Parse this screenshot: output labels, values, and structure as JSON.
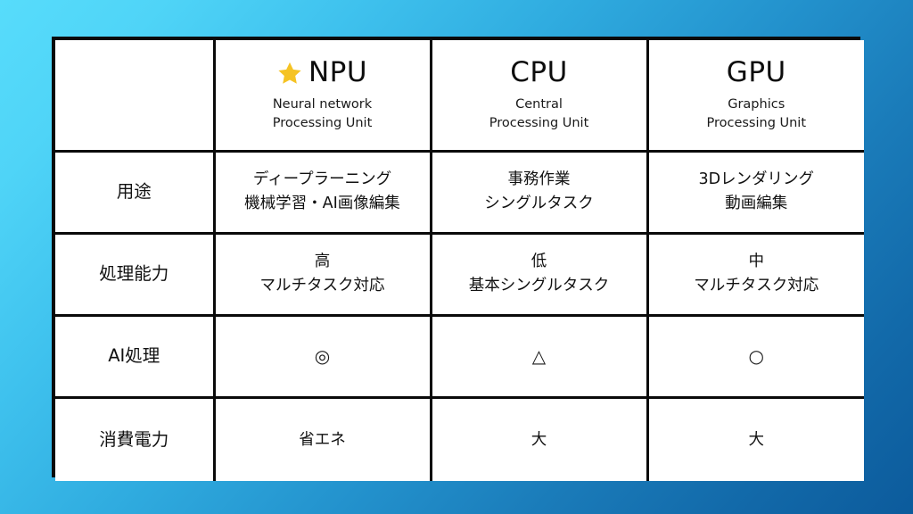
{
  "slide": {
    "background_from": "#57dcfb",
    "background_to": "#0c5b9c",
    "border_color": "#0a0a0a",
    "star_color": "#f5c324"
  },
  "table": {
    "corner_label": "",
    "columns": [
      {
        "key": "npu",
        "abbr": "NPU",
        "expansion_line1": "Neural network",
        "expansion_line2": "Processing Unit",
        "highlighted": true,
        "star_icon": "star-icon"
      },
      {
        "key": "cpu",
        "abbr": "CPU",
        "expansion_line1": "Central",
        "expansion_line2": "Processing Unit",
        "highlighted": false,
        "star_icon": ""
      },
      {
        "key": "gpu",
        "abbr": "GPU",
        "expansion_line1": "Graphics",
        "expansion_line2": "Processing Unit",
        "highlighted": false,
        "star_icon": ""
      }
    ],
    "rows": [
      {
        "key": "usage",
        "label": "用途",
        "npu_line1": "ディープラーニング",
        "npu_line2": "機械学習・AI画像編集",
        "cpu_line1": "事務作業",
        "cpu_line2": "シングルタスク",
        "gpu_line1": "3Dレンダリング",
        "gpu_line2": "動画編集"
      },
      {
        "key": "performance",
        "label": "処理能力",
        "npu_line1": "高",
        "npu_line2": "マルチタスク対応",
        "cpu_line1": "低",
        "cpu_line2": "基本シングルタスク",
        "gpu_line1": "中",
        "gpu_line2": "マルチタスク対応"
      },
      {
        "key": "ai-processing",
        "label": "AI処理",
        "npu_line1": "◎",
        "npu_line2": "",
        "cpu_line1": "△",
        "cpu_line2": "",
        "gpu_line1": "○",
        "gpu_line2": ""
      },
      {
        "key": "power-consumption",
        "label": "消費電力",
        "npu_line1": "省エネ",
        "npu_line2": "",
        "cpu_line1": "大",
        "cpu_line2": "",
        "gpu_line1": "大",
        "gpu_line2": ""
      }
    ]
  }
}
